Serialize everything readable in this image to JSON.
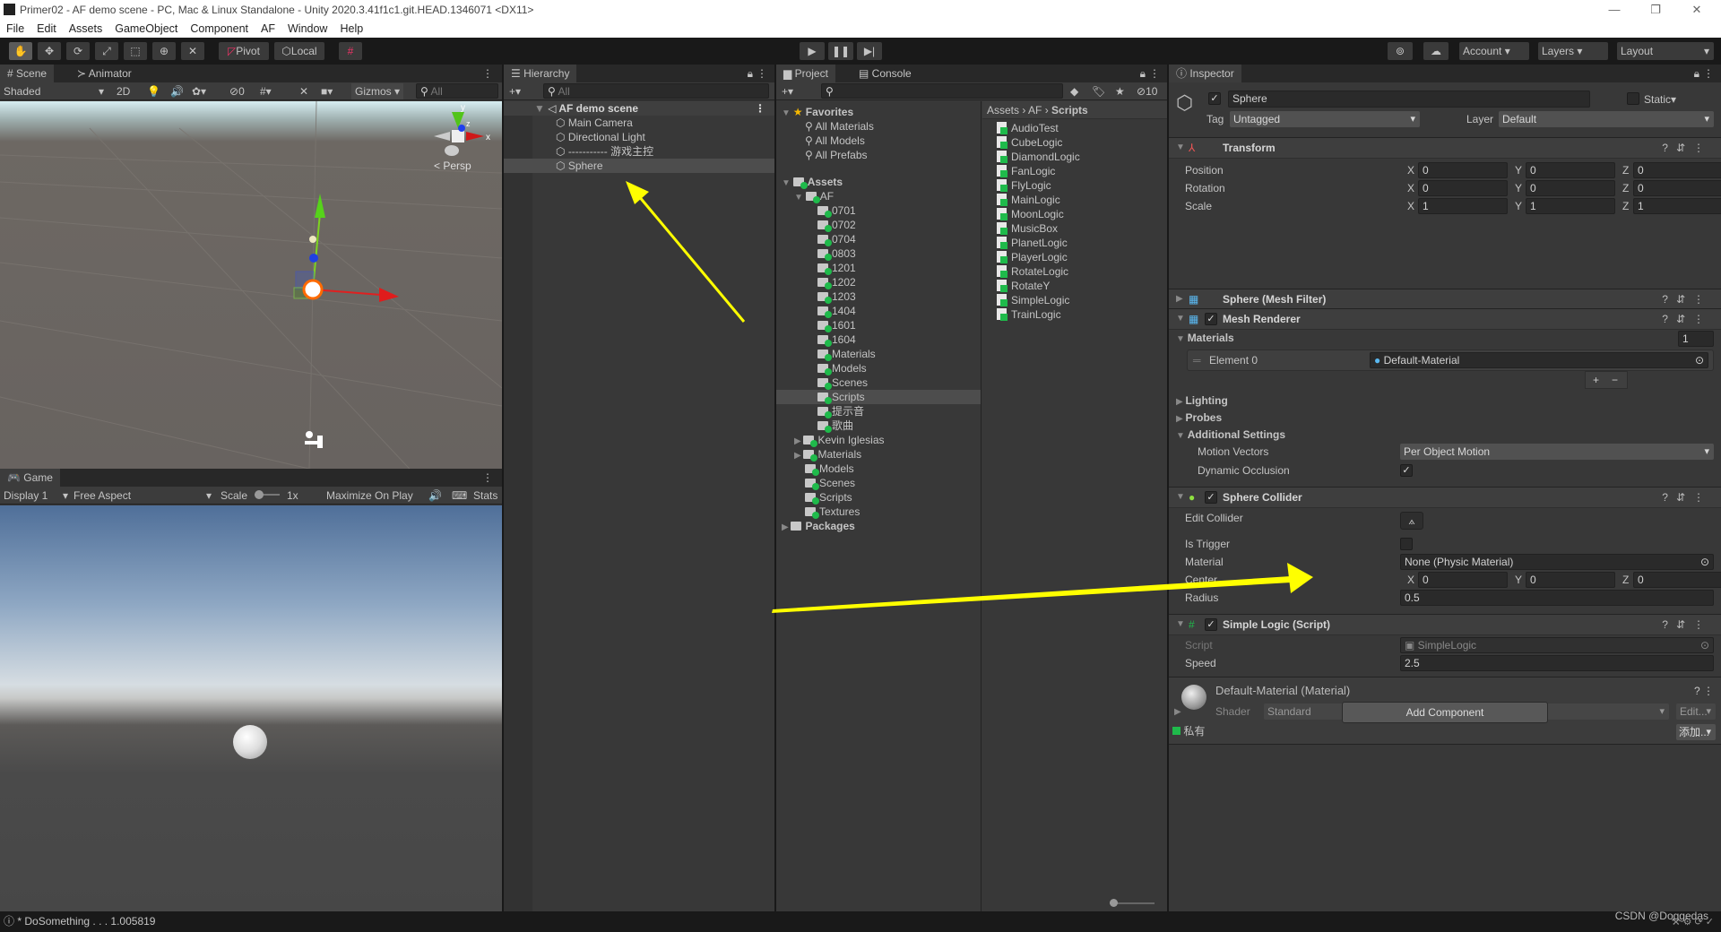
{
  "window": {
    "title": "Primer02 - AF demo scene - PC, Mac & Linux Standalone - Unity 2020.3.41f1c1.git.HEAD.1346071 <DX11>"
  },
  "menu": [
    "File",
    "Edit",
    "Assets",
    "GameObject",
    "Component",
    "AF",
    "Window",
    "Help"
  ],
  "toolbar": {
    "pivot": "Pivot",
    "local": "Local",
    "account": "Account",
    "layers": "Layers",
    "layout": "Layout"
  },
  "scene": {
    "tab_scene": "Scene",
    "tab_animator": "Animator",
    "shading": "Shaded",
    "mode_2d": "2D",
    "hidden_count": "0",
    "gizmos": "Gizmos",
    "search_placeholder": "All",
    "persp": "Persp",
    "gizmo_x": "x",
    "gizmo_y": "y",
    "gizmo_z": "z"
  },
  "game": {
    "tab": "Game",
    "display": "Display 1",
    "aspect": "Free Aspect",
    "scale_label": "Scale",
    "scale_value": "1x",
    "maximize": "Maximize On Play",
    "stats": "Stats"
  },
  "hierarchy": {
    "tab": "Hierarchy",
    "search_placeholder": "All",
    "scene_name": "AF demo scene",
    "items": [
      "Main Camera",
      "Directional Light",
      "----------- 游戏主控",
      "Sphere"
    ],
    "selected": "Sphere"
  },
  "project": {
    "tab_project": "Project",
    "tab_console": "Console",
    "hidden_count": "10",
    "favorites_label": "Favorites",
    "favorites": [
      "All Materials",
      "All Models",
      "All Prefabs"
    ],
    "assets_label": "Assets",
    "af_label": "AF",
    "af_children": [
      "0701",
      "0702",
      "0704",
      "0803",
      "1201",
      "1202",
      "1203",
      "1404",
      "1601",
      "1604",
      "Materials",
      "Models",
      "Scenes",
      "Scripts",
      "提示音",
      "歌曲"
    ],
    "assets_children": [
      "Kevin Iglesias",
      "Materials",
      "Models",
      "Scenes",
      "Scripts",
      "Textures"
    ],
    "packages_label": "Packages",
    "selected_folder": "Scripts",
    "breadcrumb": [
      "Assets",
      "AF",
      "Scripts"
    ],
    "files": [
      "AudioTest",
      "CubeLogic",
      "DiamondLogic",
      "FanLogic",
      "FlyLogic",
      "MainLogic",
      "MoonLogic",
      "MusicBox",
      "PlanetLogic",
      "PlayerLogic",
      "RotateLogic",
      "RotateY",
      "SimpleLogic",
      "TrainLogic"
    ]
  },
  "inspector": {
    "tab": "Inspector",
    "name": "Sphere",
    "static": "Static",
    "tag_label": "Tag",
    "tag": "Untagged",
    "layer_label": "Layer",
    "layer": "Default",
    "transform": {
      "title": "Transform",
      "position_label": "Position",
      "rotation_label": "Rotation",
      "scale_label": "Scale",
      "position": [
        "0",
        "0",
        "0"
      ],
      "rotation": [
        "0",
        "0",
        "0"
      ],
      "scale": [
        "1",
        "1",
        "1"
      ]
    },
    "mesh_filter": {
      "title": "Sphere (Mesh Filter)"
    },
    "mesh_renderer": {
      "title": "Mesh Renderer",
      "materials_label": "Materials",
      "materials_count": "1",
      "element0_label": "Element 0",
      "element0": "Default-Material",
      "lighting": "Lighting",
      "probes": "Probes",
      "additional": "Additional Settings",
      "motion_vectors_label": "Motion Vectors",
      "motion_vectors": "Per Object Motion",
      "dynamic_occlusion_label": "Dynamic Occlusion",
      "dynamic_occlusion": true
    },
    "sphere_collider": {
      "title": "Sphere Collider",
      "edit_collider": "Edit Collider",
      "is_trigger": "Is Trigger",
      "is_trigger_value": false,
      "material_label": "Material",
      "material": "None (Physic Material)",
      "center_label": "Center",
      "center": [
        "0",
        "0",
        "0"
      ],
      "radius_label": "Radius",
      "radius": "0.5"
    },
    "simple_logic": {
      "title": "Simple Logic (Script)",
      "script_label": "Script",
      "script": "SimpleLogic",
      "speed_label": "Speed",
      "speed": "2.5"
    },
    "material": {
      "title": "Default-Material (Material)",
      "shader_label": "Shader",
      "shader": "Standard",
      "edit": "Edit...",
      "private": "私有",
      "add": "添加..."
    },
    "add_component": "Add Component"
  },
  "status": {
    "message": "* DoSomething . . . 1.005819",
    "watermark": "CSDN @Doggedas"
  },
  "colors": {
    "accent_arrow": "#ffff00",
    "selection": "#4d4d4d",
    "script_badge": "#1fba4b"
  }
}
